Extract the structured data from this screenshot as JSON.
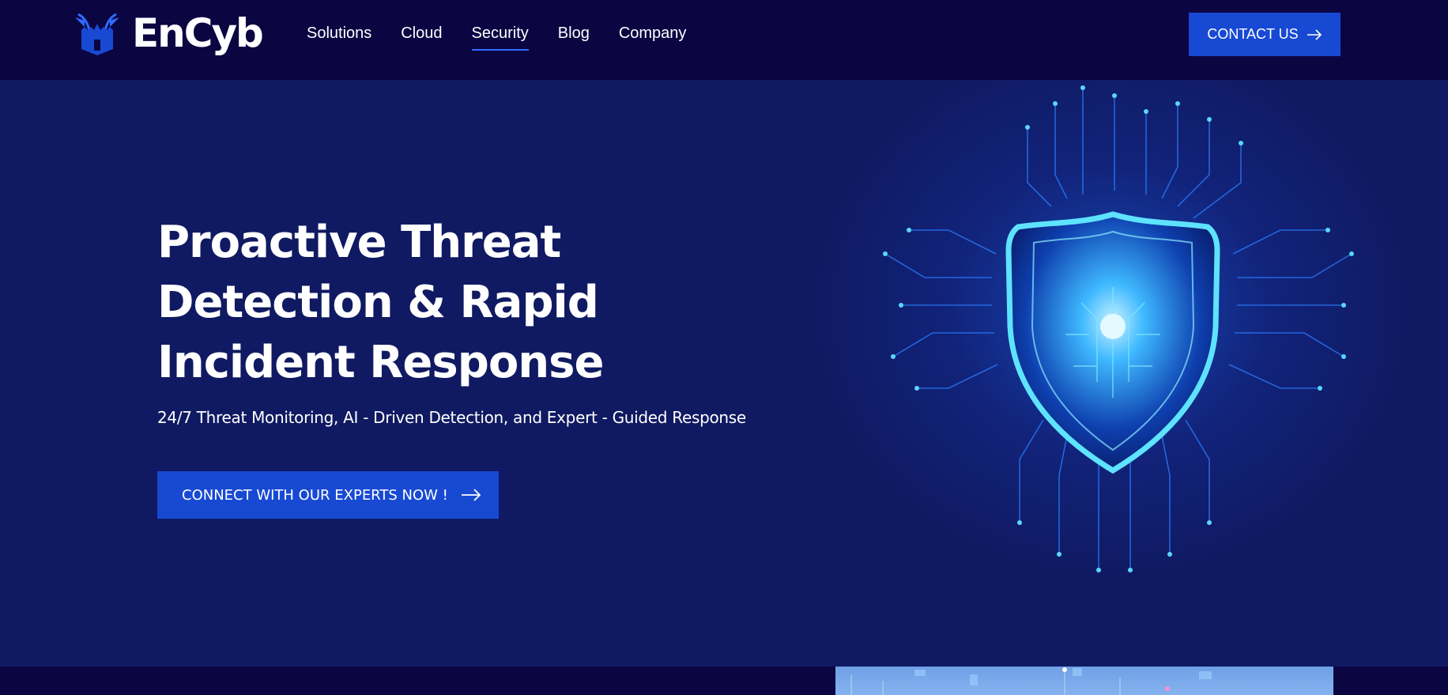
{
  "brand": {
    "name": "EnCyb"
  },
  "nav": {
    "items": [
      {
        "label": "Solutions"
      },
      {
        "label": "Cloud"
      },
      {
        "label": "Security"
      },
      {
        "label": "Blog"
      },
      {
        "label": "Company"
      }
    ],
    "active": "Security",
    "contact_label": "CONTACT US"
  },
  "hero": {
    "title_lines": [
      "Proactive Threat",
      "Detection & Rapid",
      "Incident Response"
    ],
    "subtitle": "24/7 Threat Monitoring, AI - Driven Detection, and Expert - Guided Response",
    "cta_label": "CONNECT WITH OUR EXPERTS NOW !"
  },
  "colors": {
    "nav_bg": "#0b0542",
    "hero_bg": "#101a62",
    "accent": "#1749d3",
    "active_underline": "#2f6bff",
    "shield_glow": "#35d2ff"
  },
  "icons": {
    "logo": "castle-wings-logo",
    "arrow": "arrow-right-icon",
    "hero_image": "glowing-shield-circuit"
  }
}
